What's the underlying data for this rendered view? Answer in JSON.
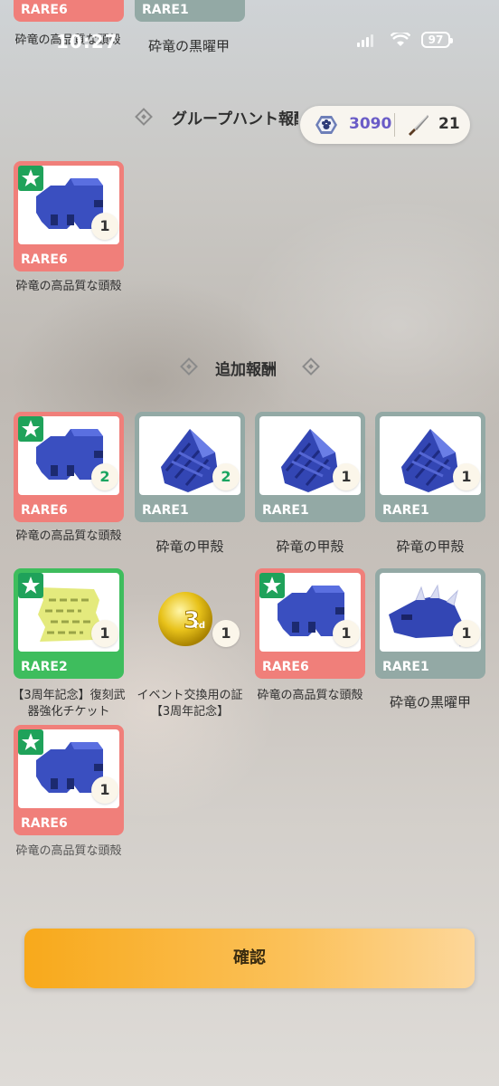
{
  "status_bar": {
    "time": "10:27",
    "battery": "97"
  },
  "top_partial": {
    "label_left": "砕竜の高品質な頭殻",
    "label_right": "砕竜の黒曜甲",
    "rare_left": "RARE6",
    "rare_right": "RARE1"
  },
  "currency": {
    "gems": "3090",
    "tickets": "21"
  },
  "group_hunt": {
    "title": "グループハント報酬",
    "items": [
      {
        "rare": "RARE6",
        "qty": "1",
        "name": "砕竜の高品質な頭殻"
      }
    ]
  },
  "bonus": {
    "title": "追加報酬",
    "items": [
      {
        "rare": "RARE6",
        "qty": "2",
        "name": "砕竜の高品質な頭殻"
      },
      {
        "rare": "RARE1",
        "qty": "2",
        "name": "砕竜の甲殻"
      },
      {
        "rare": "RARE1",
        "qty": "1",
        "name": "砕竜の甲殻"
      },
      {
        "rare": "RARE1",
        "qty": "1",
        "name": "砕竜の甲殻"
      },
      {
        "rare": "RARE2",
        "qty": "1",
        "name": "【3周年記念】復刻武器強化チケット"
      },
      {
        "rare": "",
        "qty": "1",
        "name": "イベント交換用の証【3周年記念】"
      },
      {
        "rare": "RARE6",
        "qty": "1",
        "name": "砕竜の高品質な頭殻"
      },
      {
        "rare": "RARE1",
        "qty": "1",
        "name": "砕竜の黒曜甲"
      },
      {
        "rare": "RARE6",
        "qty": "1",
        "name": "砕竜の高品質な頭殻"
      }
    ]
  },
  "confirm_label": "確認",
  "colors": {
    "rare6": "#f07f7a",
    "rare1": "#93a9a5",
    "rare2": "#3ebd5d",
    "accent": "#f8a91b"
  }
}
